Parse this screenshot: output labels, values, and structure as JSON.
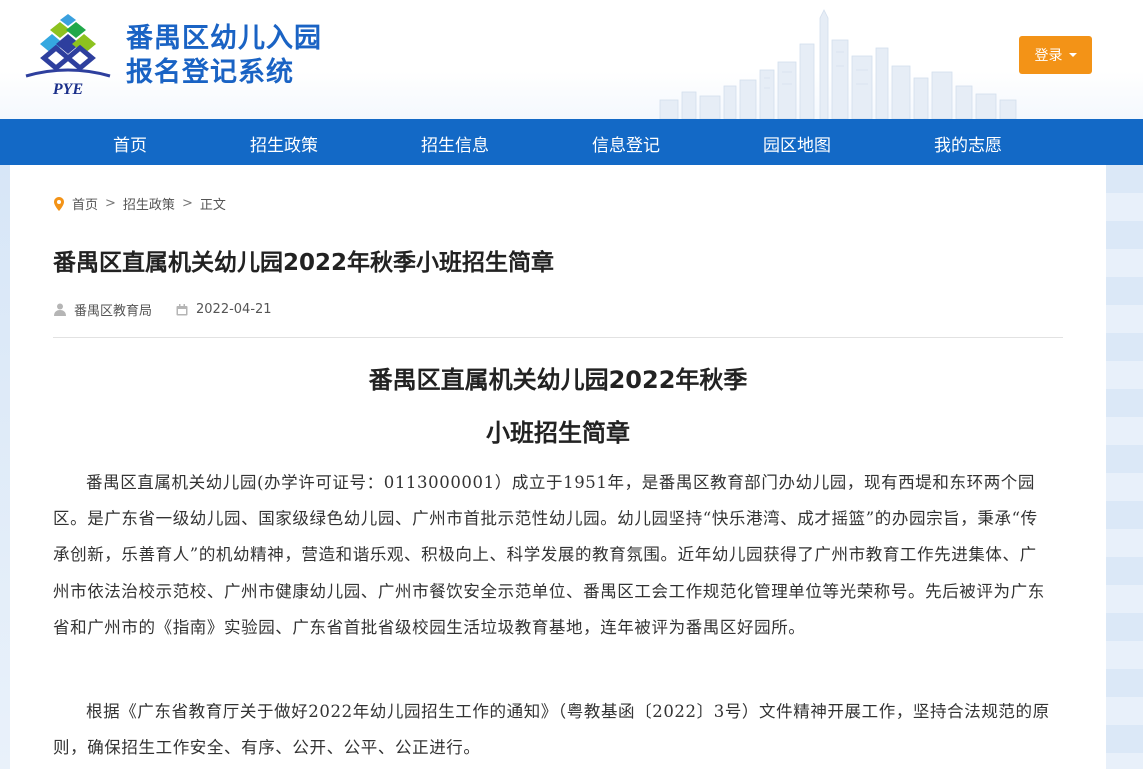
{
  "header": {
    "logo_text": "PYE",
    "title_line1": "番禺区幼儿入园",
    "title_line2": "报名登记系统",
    "login_label": "登录"
  },
  "nav": {
    "items": [
      "首页",
      "招生政策",
      "招生信息",
      "信息登记",
      "园区地图",
      "我的志愿"
    ]
  },
  "breadcrumb": {
    "items": [
      "首页",
      "招生政策",
      "正文"
    ],
    "separator": ">"
  },
  "article": {
    "title": "番禺区直属机关幼儿园2022年秋季小班招生简章",
    "author": "番禺区教育局",
    "date": "2022-04-21",
    "doc_title_line1": "番禺区直属机关幼儿园2022年秋季",
    "doc_title_line2": "小班招生简章",
    "paragraphs": [
      "番禺区直属机关幼儿园(办学许可证号：0113000001）成立于1951年，是番禺区教育部门办幼儿园，现有西堤和东环两个园区。是广东省一级幼儿园、国家级绿色幼儿园、广州市首批示范性幼儿园。幼儿园坚持“快乐港湾、成才摇篮”的办园宗旨，秉承“传承创新，乐善育人”的机幼精神，营造和谐乐观、积极向上、科学发展的教育氛围。近年幼儿园获得了广州市教育工作先进集体、广州市依法治校示范校、广州市健康幼儿园、广州市餐饮安全示范单位、番禺区工会工作规范化管理单位等光荣称号。先后被评为广东省和广州市的《指南》实验园、广东省首批省级校园生活垃圾教育基地，连年被评为番禺区好园所。",
      "根据《广东省教育厅关于做好2022年幼儿园招生工作的通知》（粤教基函〔2022〕3号）文件精神开展工作，坚持合法规范的原则，确保招生工作安全、有序、公开、公平、公正进行。"
    ]
  },
  "colors": {
    "brand_blue": "#1369c6",
    "title_blue": "#1a63c4",
    "login_orange": "#f39317",
    "pin_orange": "#f39317"
  },
  "icons": {
    "location": "map-pin-icon",
    "author": "user-icon",
    "date": "calendar-icon",
    "dropdown": "caret-down-icon"
  }
}
